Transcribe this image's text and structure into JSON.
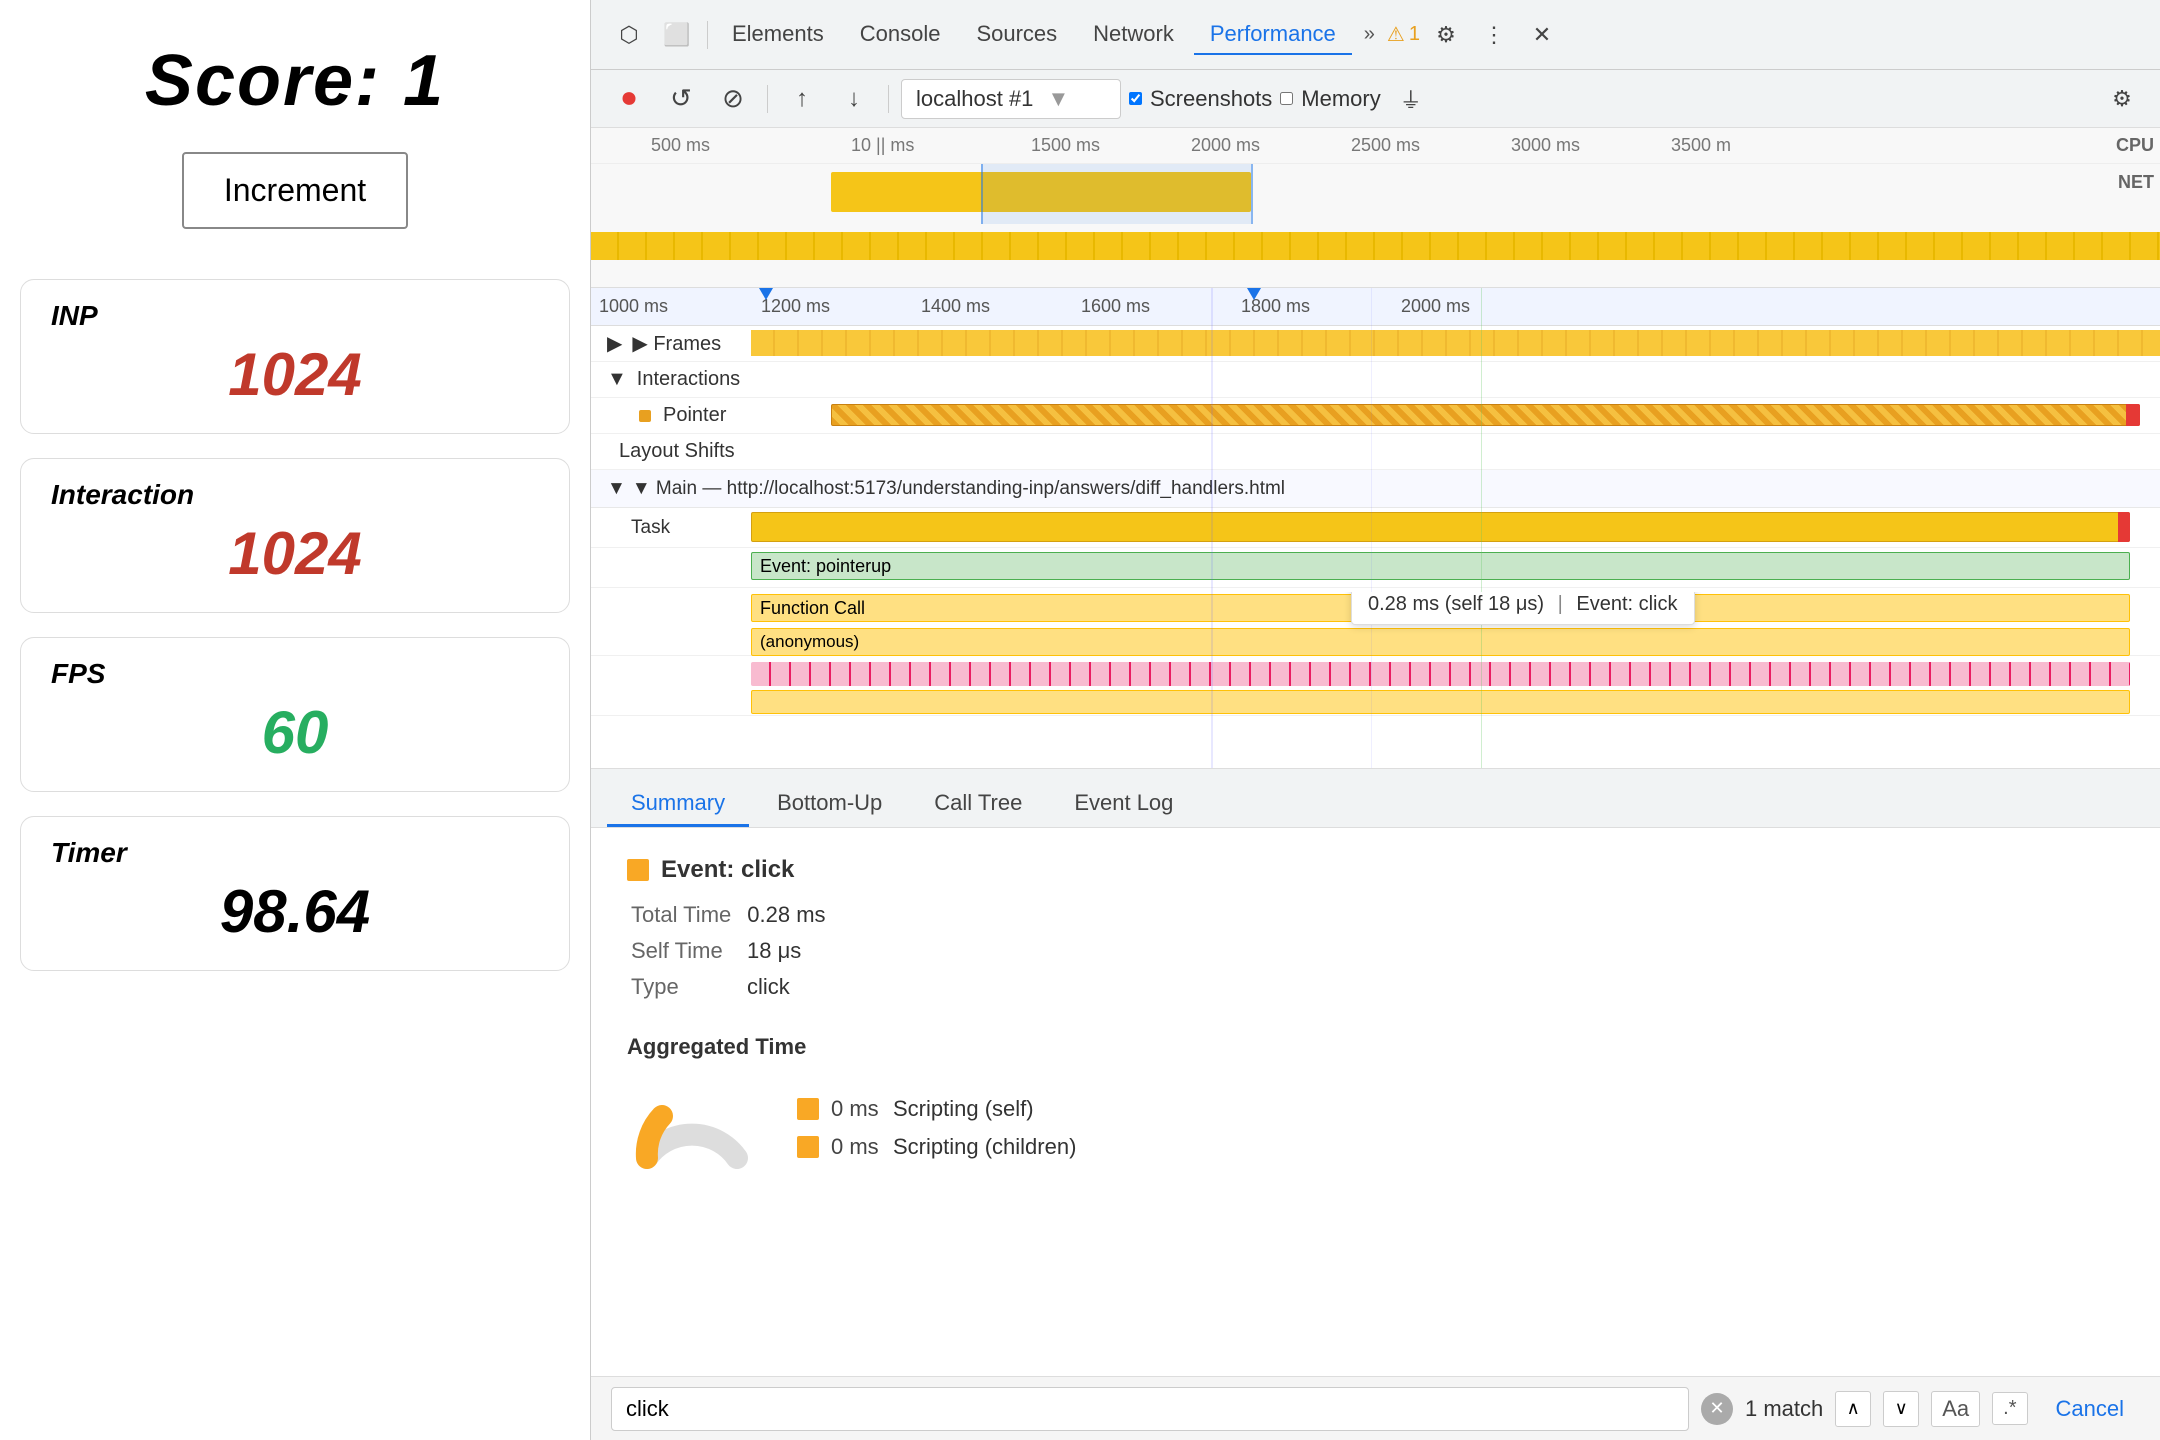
{
  "left": {
    "score_label": "Score: 1",
    "increment_btn": "Increment",
    "metrics": [
      {
        "label": "INP",
        "value": "1024",
        "color": "red"
      },
      {
        "label": "Interaction",
        "value": "1024",
        "color": "red"
      },
      {
        "label": "FPS",
        "value": "60",
        "color": "green"
      },
      {
        "label": "Timer",
        "value": "98.64",
        "color": "black"
      }
    ]
  },
  "devtools": {
    "tabs": [
      "Elements",
      "Console",
      "Sources",
      "Network",
      "Performance"
    ],
    "active_tab": "Performance",
    "url": "localhost #1",
    "screenshots_label": "Screenshots",
    "memory_label": "Memory",
    "toolbar": {
      "record": "⏺",
      "reload": "↺",
      "clear": "⊘",
      "upload": "↑",
      "download": "↓"
    }
  },
  "timeline": {
    "ruler1_ticks": [
      "500 ms",
      "10 || ms",
      "1500 ms",
      "2000 ms",
      "2500 ms",
      "3000 ms",
      "3500 m"
    ],
    "ruler2_ticks": [
      "1000 ms",
      "1200 ms",
      "1400 ms",
      "1600 ms",
      "1800 ms",
      "2000 ms"
    ],
    "tracks": {
      "frames_label": "▶ Frames",
      "interactions_label": "▼ Interactions",
      "pointer_label": "Pointer",
      "layout_shifts_label": "Layout Shifts",
      "main_url": "▼ Main — http://localhost:5173/understanding-inp/answers/diff_handlers.html",
      "task_label": "Task",
      "event_pointerup": "Event: pointerup",
      "function_call": "Function Call",
      "anonymous": "(anonymous)"
    }
  },
  "tooltip": {
    "time": "0.28 ms (self 18 μs)",
    "label": "Event: click"
  },
  "bottom_tabs": [
    "Summary",
    "Bottom-Up",
    "Call Tree",
    "Event Log"
  ],
  "active_bottom_tab": "Summary",
  "summary": {
    "event_title": "Event: click",
    "total_time_label": "Total Time",
    "total_time_value": "0.28 ms",
    "self_time_label": "Self Time",
    "self_time_value": "18 μs",
    "type_label": "Type",
    "type_value": "click",
    "aggregated_time_label": "Aggregated Time",
    "legend": [
      {
        "label": "Scripting (self)",
        "value": "0 ms",
        "color": "#f9a825"
      },
      {
        "label": "Scripting (children)",
        "value": "0 ms",
        "color": "#f9a825"
      }
    ]
  },
  "search": {
    "value": "click",
    "match_text": "1 match",
    "cancel_label": "Cancel"
  },
  "icons": {
    "cursor": "⬡",
    "screenshot_icon": "⬜",
    "gear": "⚙",
    "more": "⋮",
    "close": "✕",
    "warning": "⚠",
    "triangle_up": "▲",
    "triangle_down": "▼",
    "chevron_up": "^",
    "chevron_down": "v"
  }
}
